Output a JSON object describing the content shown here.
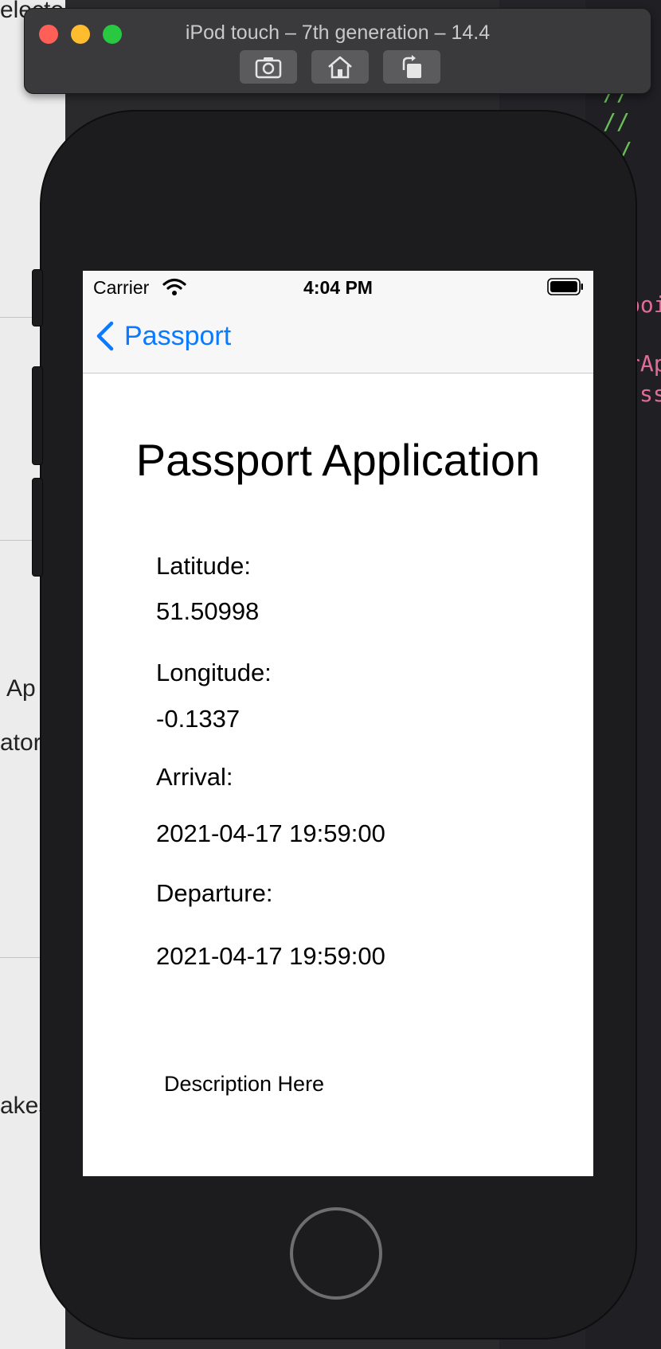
{
  "simulator": {
    "title": "iPod touch – 7th generation – 14.4",
    "buttons": [
      "screenshot",
      "home",
      "rotate"
    ]
  },
  "status_bar": {
    "carrier": "Carrier",
    "time": "4:04 PM"
  },
  "nav": {
    "back_label": "Passport"
  },
  "content": {
    "title": "Passport Application",
    "latitude_label": "Latitude:",
    "latitude_value": "51.50998",
    "longitude_label": "Longitude:",
    "longitude_value": "-0.1337",
    "arrival_label": "Arrival:",
    "arrival_value": "2021-04-17 19:59:00",
    "departure_label": "Departure:",
    "departure_value": "2021-04-17 19:59:00",
    "description": "Description Here"
  },
  "background": {
    "left_fragments": [
      "electo",
      "Ap",
      "ator",
      "akes"
    ],
    "editor_fragments": [
      "//",
      "//",
      "/",
      "poi",
      "rAp",
      "ss"
    ]
  },
  "colors": {
    "tint": "#0a7aff",
    "device": "#1c1c1e"
  }
}
